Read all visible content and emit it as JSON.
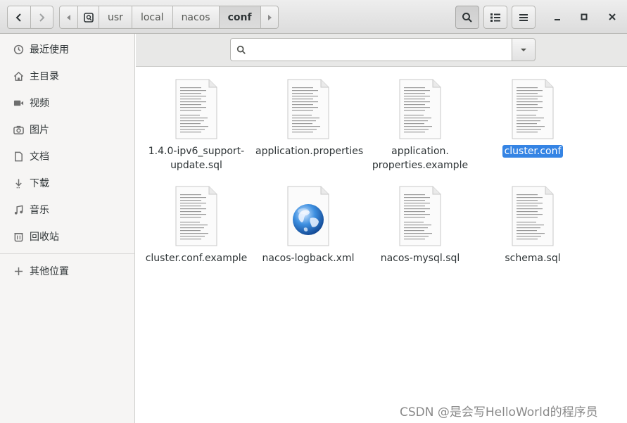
{
  "header": {
    "path_segments": [
      "usr",
      "local",
      "nacos",
      "conf"
    ],
    "active_segment_index": 3
  },
  "sidebar": {
    "items": [
      {
        "label": "最近使用",
        "icon": "clock-icon"
      },
      {
        "label": "主目录",
        "icon": "home-icon"
      },
      {
        "label": "视频",
        "icon": "video-icon"
      },
      {
        "label": "图片",
        "icon": "camera-icon"
      },
      {
        "label": "文档",
        "icon": "document-icon"
      },
      {
        "label": "下载",
        "icon": "download-icon"
      },
      {
        "label": "音乐",
        "icon": "music-icon"
      },
      {
        "label": "回收站",
        "icon": "trash-icon"
      }
    ],
    "other_locations": {
      "label": "其他位置",
      "icon": "plus-icon"
    }
  },
  "search": {
    "value": "",
    "placeholder": ""
  },
  "files": [
    {
      "name": "1.4.0-ipv6_support-update.sql",
      "icon": "text-file-icon",
      "selected": false
    },
    {
      "name": "application.properties",
      "icon": "text-file-icon",
      "selected": false
    },
    {
      "name": "application.properties.example",
      "icon": "text-file-icon",
      "selected": false
    },
    {
      "name": "cluster.conf",
      "icon": "text-file-icon",
      "selected": true
    },
    {
      "name": "cluster.conf.example",
      "icon": "text-file-icon",
      "selected": false
    },
    {
      "name": "nacos-logback.xml",
      "icon": "xml-globe-file-icon",
      "selected": false
    },
    {
      "name": "nacos-mysql.sql",
      "icon": "text-file-icon",
      "selected": false
    },
    {
      "name": "schema.sql",
      "icon": "text-file-icon",
      "selected": false
    }
  ],
  "file_labels": {
    "f0_l1": "1.4.0-ipv6_support-",
    "f0_l2": "update.sql",
    "f2_l1": "application.",
    "f2_l2": "properties.example"
  },
  "colors": {
    "selection": "#3584e4",
    "sidebar_bg": "#f6f5f4",
    "header_bg": "#e6e6e6"
  },
  "watermark": "CSDN @是会写HelloWorld的程序员"
}
